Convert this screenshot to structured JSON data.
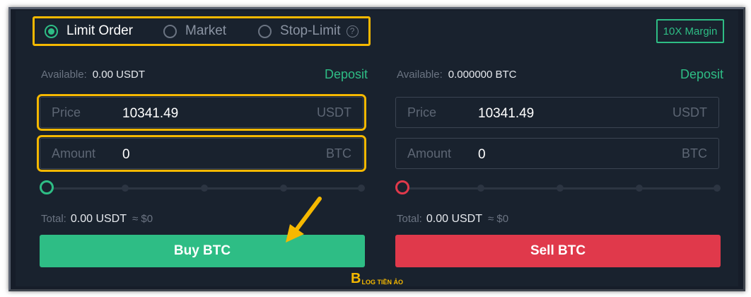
{
  "order_types": [
    {
      "label": "Limit Order",
      "selected": true
    },
    {
      "label": "Market",
      "selected": false
    },
    {
      "label": "Stop-Limit",
      "selected": false
    }
  ],
  "help_icon": "?",
  "margin_button": "10X Margin",
  "buy": {
    "available_label": "Available:",
    "available_value": "0.00 USDT",
    "deposit": "Deposit",
    "price_label": "Price",
    "price_value": "10341.49",
    "price_unit": "USDT",
    "amount_label": "Amount",
    "amount_value": "0",
    "amount_unit": "BTC",
    "slider_level": 0,
    "total_label": "Total:",
    "total_value": "0.00 USDT",
    "total_approx": "≈ $0",
    "button": "Buy BTC"
  },
  "sell": {
    "available_label": "Available:",
    "available_value": "0.000000 BTC",
    "deposit": "Deposit",
    "price_label": "Price",
    "price_value": "10341.49",
    "price_unit": "USDT",
    "amount_label": "Amount",
    "amount_value": "0",
    "amount_unit": "BTC",
    "slider_level": 0,
    "total_label": "Total:",
    "total_value": "0.00 USDT",
    "total_approx": "≈ $0",
    "button": "Sell BTC"
  },
  "watermark": {
    "logo": "B",
    "text": "LOG TIỀN ẢO"
  },
  "colors": {
    "buy": "#2ebd85",
    "sell": "#e0394b",
    "highlight": "#f5b800",
    "background": "#19222e"
  }
}
